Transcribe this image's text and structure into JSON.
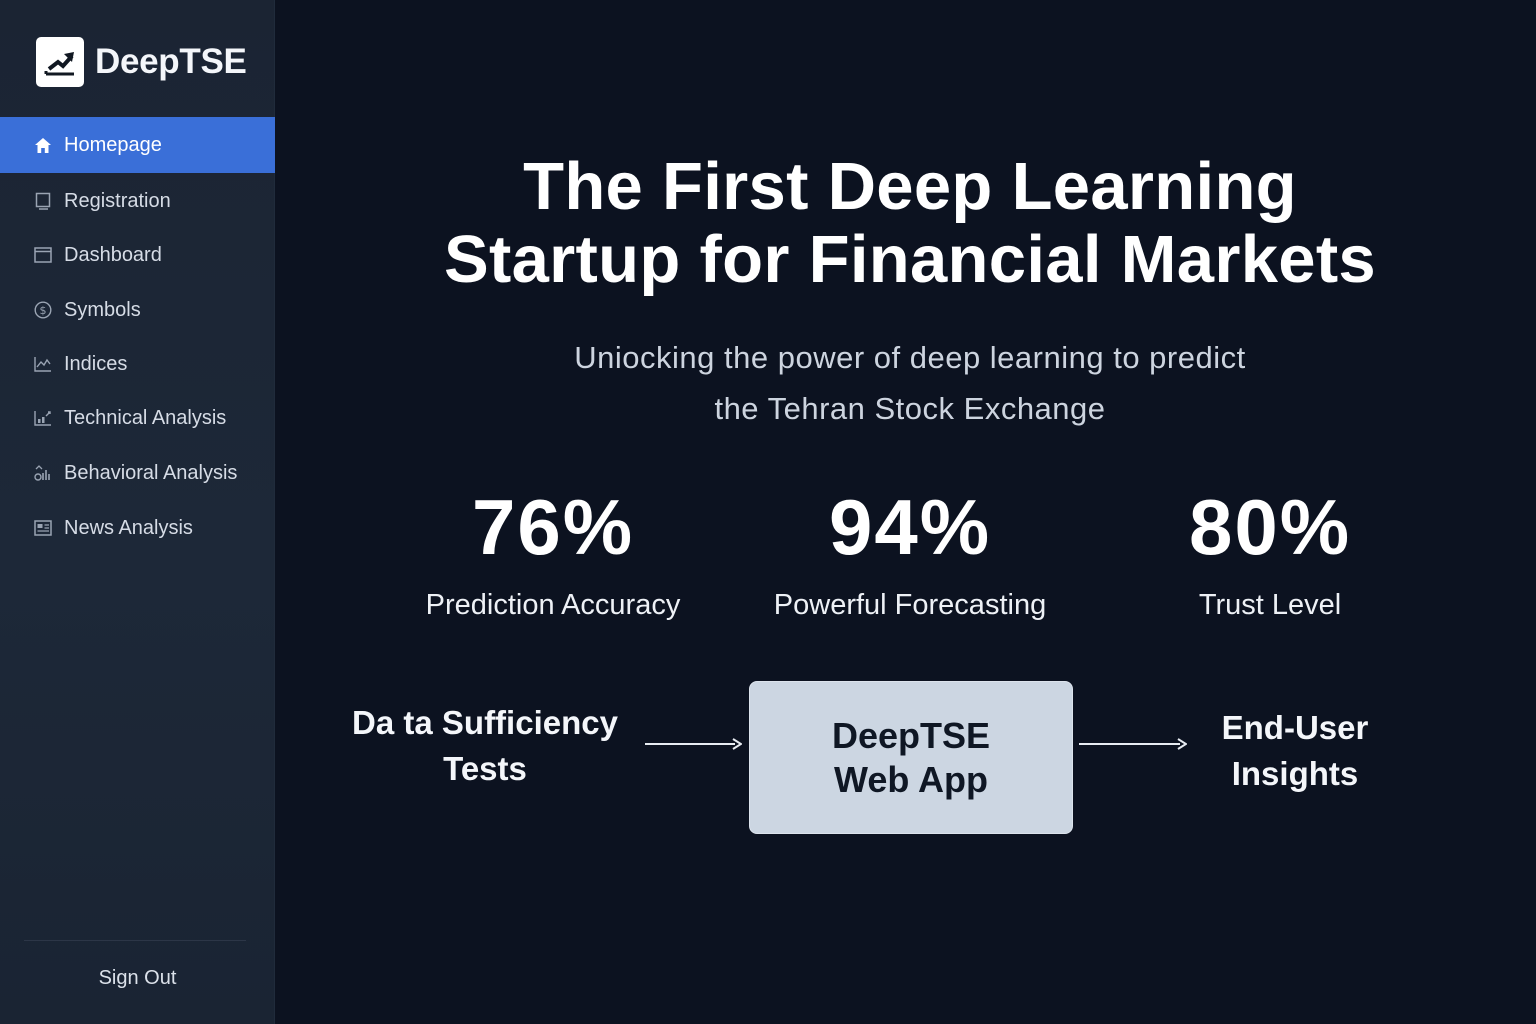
{
  "brand": {
    "name": "DeepTSE",
    "logo_icon": "trending-up-chart-icon"
  },
  "sidebar": {
    "items": [
      {
        "label": "Homepage",
        "icon": "home-icon",
        "active": true
      },
      {
        "label": "Registration",
        "icon": "registration-icon",
        "active": false
      },
      {
        "label": "Dashboard",
        "icon": "dashboard-icon",
        "active": false
      },
      {
        "label": "Symbols",
        "icon": "dollar-circle-icon",
        "active": false
      },
      {
        "label": "Indices",
        "icon": "line-chart-icon",
        "active": false
      },
      {
        "label": "Technical Analysis",
        "icon": "technical-chart-icon",
        "active": false
      },
      {
        "label": "Behavioral Analysis",
        "icon": "behavioral-icon",
        "active": false
      },
      {
        "label": "News Analysis",
        "icon": "newspaper-icon",
        "active": false
      }
    ],
    "sign_out": "Sign Out"
  },
  "hero": {
    "title_line1": "The First Deep Learning",
    "title_line2": "Startup for Financial Markets",
    "subtitle_line1": "Uniocking the power of deep learning to predict",
    "subtitle_line2": "the Tehran Stock Exchange"
  },
  "stats": [
    {
      "value": "76%",
      "label": "Prediction Accuracy"
    },
    {
      "value": "94%",
      "label": "Powerful Forecasting"
    },
    {
      "value": "80%",
      "label": "Trust Level"
    }
  ],
  "flow": {
    "input_line1": "Da ta Sufficiency",
    "input_line2": "Tests",
    "center_line1": "DeepTSE",
    "center_line2": "Web App",
    "output_line1": "End-User",
    "output_line2": "Insights"
  },
  "colors": {
    "background": "#0c1220",
    "sidebar": "#1d2838",
    "active_nav": "#3a6fd8",
    "flow_box": "#ccd6e2"
  }
}
